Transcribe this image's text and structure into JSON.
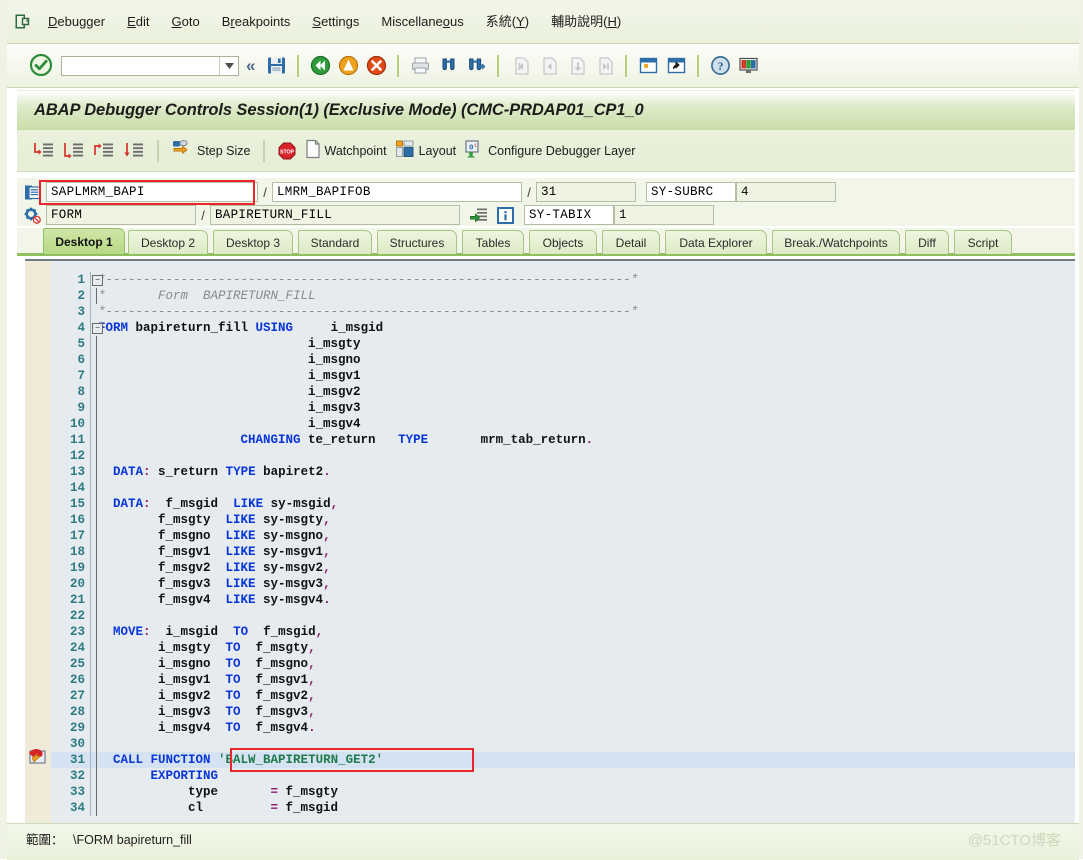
{
  "menu": {
    "items": [
      {
        "label": "Debugger",
        "accel": "D"
      },
      {
        "label": "Edit",
        "accel": "E"
      },
      {
        "label": "Goto",
        "accel": "G"
      },
      {
        "label": "Breakpoints",
        "accel": "r"
      },
      {
        "label": "Settings",
        "accel": "S"
      },
      {
        "label": "Miscellaneous",
        "accel": "o"
      },
      {
        "label": "系統(Y)",
        "accel": ""
      },
      {
        "label": "輔助說明(H)",
        "accel": ""
      }
    ]
  },
  "toolbar": {
    "command_value": "",
    "command_placeholder": "",
    "icons": [
      "enter-ok-icon",
      "save-icon",
      "back-icon",
      "exit-icon",
      "cancel-icon",
      "print-icon",
      "find-icon",
      "find-next-icon",
      "first-page-icon",
      "previous-page-icon",
      "next-page-icon",
      "last-page-icon",
      "create-session-icon",
      "create-shortcut-icon",
      "help-icon",
      "customize-icon"
    ]
  },
  "window": {
    "title": "ABAP Debugger Controls Session(1)  (Exclusive Mode) (CMC-PRDAP01_CP1_0"
  },
  "debug_toolbar": {
    "buttons": [
      {
        "name": "step-into-button",
        "label": ""
      },
      {
        "name": "step-over-button",
        "label": ""
      },
      {
        "name": "return-button",
        "label": ""
      },
      {
        "name": "continue-button",
        "label": ""
      },
      {
        "name": "step-size-button",
        "label": "Step Size"
      },
      {
        "name": "stop-button",
        "label": ""
      },
      {
        "name": "watchpoint-button",
        "label": "Watchpoint"
      },
      {
        "name": "layout-button",
        "label": "Layout"
      },
      {
        "name": "configure-debugger-layer-button",
        "label": "Configure Debugger Layer"
      }
    ]
  },
  "fields": {
    "row1": {
      "program": "SAPLMRM_BAPI",
      "include": "LMRM_BAPIFOB",
      "line": "31",
      "sy_subrc_label": "SY-SUBRC",
      "sy_subrc_value": "4"
    },
    "row2": {
      "event_type": "FORM",
      "event_name": "BAPIRETURN_FILL",
      "sy_tabix_label": "SY-TABIX",
      "sy_tabix_value": "1"
    },
    "separator": "/"
  },
  "tabs": {
    "items": [
      {
        "label": "Desktop 1",
        "active": true
      },
      {
        "label": "Desktop 2",
        "active": false
      },
      {
        "label": "Desktop 3",
        "active": false
      },
      {
        "label": "Standard",
        "active": false
      },
      {
        "label": "Structures",
        "active": false
      },
      {
        "label": "Tables",
        "active": false
      },
      {
        "label": "Objects",
        "active": false
      },
      {
        "label": "Detail",
        "active": false
      },
      {
        "label": "Data Explorer",
        "active": false
      },
      {
        "label": "Break./Watchpoints",
        "active": false
      },
      {
        "label": "Diff",
        "active": false
      },
      {
        "label": "Script",
        "active": false
      }
    ]
  },
  "code": {
    "current_line": 31,
    "lines": [
      {
        "n": 1,
        "tokens": [
          {
            "t": "*----------------------------------------------------------------------*",
            "c": "cm"
          }
        ]
      },
      {
        "n": 2,
        "tokens": [
          {
            "t": "*       Form  BAPIRETURN_FILL",
            "c": "cm"
          }
        ]
      },
      {
        "n": 3,
        "tokens": [
          {
            "t": "*----------------------------------------------------------------------*",
            "c": "cm"
          }
        ]
      },
      {
        "n": 4,
        "tokens": [
          {
            "t": "FORM",
            "c": "kw"
          },
          {
            "t": " bapireturn_fill ",
            "c": "id"
          },
          {
            "t": "USING",
            "c": "kw"
          },
          {
            "t": "     i_msgid",
            "c": "id"
          }
        ]
      },
      {
        "n": 5,
        "tokens": [
          {
            "t": "                            i_msgty",
            "c": "id"
          }
        ]
      },
      {
        "n": 6,
        "tokens": [
          {
            "t": "                            i_msgno",
            "c": "id"
          }
        ]
      },
      {
        "n": 7,
        "tokens": [
          {
            "t": "                            i_msgv1",
            "c": "id"
          }
        ]
      },
      {
        "n": 8,
        "tokens": [
          {
            "t": "                            i_msgv2",
            "c": "id"
          }
        ]
      },
      {
        "n": 9,
        "tokens": [
          {
            "t": "                            i_msgv3",
            "c": "id"
          }
        ]
      },
      {
        "n": 10,
        "tokens": [
          {
            "t": "                            i_msgv4",
            "c": "id"
          }
        ]
      },
      {
        "n": 11,
        "tokens": [
          {
            "t": "                   ",
            "c": "id"
          },
          {
            "t": "CHANGING",
            "c": "kw"
          },
          {
            "t": " te_return   ",
            "c": "id"
          },
          {
            "t": "TYPE",
            "c": "kw"
          },
          {
            "t": "       mrm_tab_return",
            "c": "id"
          },
          {
            "t": ".",
            "c": "pn"
          }
        ]
      },
      {
        "n": 12,
        "tokens": []
      },
      {
        "n": 13,
        "tokens": [
          {
            "t": "  ",
            "c": "id"
          },
          {
            "t": "DATA",
            "c": "kw"
          },
          {
            "t": ":",
            "c": "pn"
          },
          {
            "t": " s_return ",
            "c": "id"
          },
          {
            "t": "TYPE",
            "c": "kw"
          },
          {
            "t": " bapiret2",
            "c": "id"
          },
          {
            "t": ".",
            "c": "pn"
          }
        ]
      },
      {
        "n": 14,
        "tokens": []
      },
      {
        "n": 15,
        "tokens": [
          {
            "t": "  ",
            "c": "id"
          },
          {
            "t": "DATA",
            "c": "kw"
          },
          {
            "t": ":",
            "c": "pn"
          },
          {
            "t": "  f_msgid  ",
            "c": "id"
          },
          {
            "t": "LIKE",
            "c": "kw"
          },
          {
            "t": " sy-msgid",
            "c": "id"
          },
          {
            "t": ",",
            "c": "pn"
          }
        ]
      },
      {
        "n": 16,
        "tokens": [
          {
            "t": "        f_msgty  ",
            "c": "id"
          },
          {
            "t": "LIKE",
            "c": "kw"
          },
          {
            "t": " sy-msgty",
            "c": "id"
          },
          {
            "t": ",",
            "c": "pn"
          }
        ]
      },
      {
        "n": 17,
        "tokens": [
          {
            "t": "        f_msgno  ",
            "c": "id"
          },
          {
            "t": "LIKE",
            "c": "kw"
          },
          {
            "t": " sy-msgno",
            "c": "id"
          },
          {
            "t": ",",
            "c": "pn"
          }
        ]
      },
      {
        "n": 18,
        "tokens": [
          {
            "t": "        f_msgv1  ",
            "c": "id"
          },
          {
            "t": "LIKE",
            "c": "kw"
          },
          {
            "t": " sy-msgv1",
            "c": "id"
          },
          {
            "t": ",",
            "c": "pn"
          }
        ]
      },
      {
        "n": 19,
        "tokens": [
          {
            "t": "        f_msgv2  ",
            "c": "id"
          },
          {
            "t": "LIKE",
            "c": "kw"
          },
          {
            "t": " sy-msgv2",
            "c": "id"
          },
          {
            "t": ",",
            "c": "pn"
          }
        ]
      },
      {
        "n": 20,
        "tokens": [
          {
            "t": "        f_msgv3  ",
            "c": "id"
          },
          {
            "t": "LIKE",
            "c": "kw"
          },
          {
            "t": " sy-msgv3",
            "c": "id"
          },
          {
            "t": ",",
            "c": "pn"
          }
        ]
      },
      {
        "n": 21,
        "tokens": [
          {
            "t": "        f_msgv4  ",
            "c": "id"
          },
          {
            "t": "LIKE",
            "c": "kw"
          },
          {
            "t": " sy-msgv4",
            "c": "id"
          },
          {
            "t": ".",
            "c": "pn"
          }
        ]
      },
      {
        "n": 22,
        "tokens": []
      },
      {
        "n": 23,
        "tokens": [
          {
            "t": "  ",
            "c": "id"
          },
          {
            "t": "MOVE",
            "c": "kw"
          },
          {
            "t": ":",
            "c": "pn"
          },
          {
            "t": "  i_msgid  ",
            "c": "id"
          },
          {
            "t": "TO",
            "c": "kw"
          },
          {
            "t": "  f_msgid",
            "c": "id"
          },
          {
            "t": ",",
            "c": "pn"
          }
        ]
      },
      {
        "n": 24,
        "tokens": [
          {
            "t": "        i_msgty  ",
            "c": "id"
          },
          {
            "t": "TO",
            "c": "kw"
          },
          {
            "t": "  f_msgty",
            "c": "id"
          },
          {
            "t": ",",
            "c": "pn"
          }
        ]
      },
      {
        "n": 25,
        "tokens": [
          {
            "t": "        i_msgno  ",
            "c": "id"
          },
          {
            "t": "TO",
            "c": "kw"
          },
          {
            "t": "  f_msgno",
            "c": "id"
          },
          {
            "t": ",",
            "c": "pn"
          }
        ]
      },
      {
        "n": 26,
        "tokens": [
          {
            "t": "        i_msgv1  ",
            "c": "id"
          },
          {
            "t": "TO",
            "c": "kw"
          },
          {
            "t": "  f_msgv1",
            "c": "id"
          },
          {
            "t": ",",
            "c": "pn"
          }
        ]
      },
      {
        "n": 27,
        "tokens": [
          {
            "t": "        i_msgv2  ",
            "c": "id"
          },
          {
            "t": "TO",
            "c": "kw"
          },
          {
            "t": "  f_msgv2",
            "c": "id"
          },
          {
            "t": ",",
            "c": "pn"
          }
        ]
      },
      {
        "n": 28,
        "tokens": [
          {
            "t": "        i_msgv3  ",
            "c": "id"
          },
          {
            "t": "TO",
            "c": "kw"
          },
          {
            "t": "  f_msgv3",
            "c": "id"
          },
          {
            "t": ",",
            "c": "pn"
          }
        ]
      },
      {
        "n": 29,
        "tokens": [
          {
            "t": "        i_msgv4  ",
            "c": "id"
          },
          {
            "t": "TO",
            "c": "kw"
          },
          {
            "t": "  f_msgv4",
            "c": "id"
          },
          {
            "t": ".",
            "c": "pn"
          }
        ]
      },
      {
        "n": 30,
        "tokens": []
      },
      {
        "n": 31,
        "tokens": [
          {
            "t": "  ",
            "c": "id"
          },
          {
            "t": "CALL FUNCTION",
            "c": "kw"
          },
          {
            "t": " 'BALW_BAPIRETURN_GET2'",
            "c": "st"
          }
        ],
        "highlight": true
      },
      {
        "n": 32,
        "tokens": [
          {
            "t": "       ",
            "c": "id"
          },
          {
            "t": "EXPORTING",
            "c": "kw"
          }
        ]
      },
      {
        "n": 33,
        "tokens": [
          {
            "t": "            type       ",
            "c": "id"
          },
          {
            "t": "=",
            "c": "pn"
          },
          {
            "t": " f_msgty",
            "c": "id"
          }
        ]
      },
      {
        "n": 34,
        "tokens": [
          {
            "t": "            cl         ",
            "c": "id"
          },
          {
            "t": "=",
            "c": "pn"
          },
          {
            "t": " f_msgid",
            "c": "id"
          }
        ]
      }
    ]
  },
  "status": {
    "scope_label": "範圍：",
    "scope_value": "\\FORM bapireturn_fill",
    "watermark": "@51CTO博客"
  }
}
